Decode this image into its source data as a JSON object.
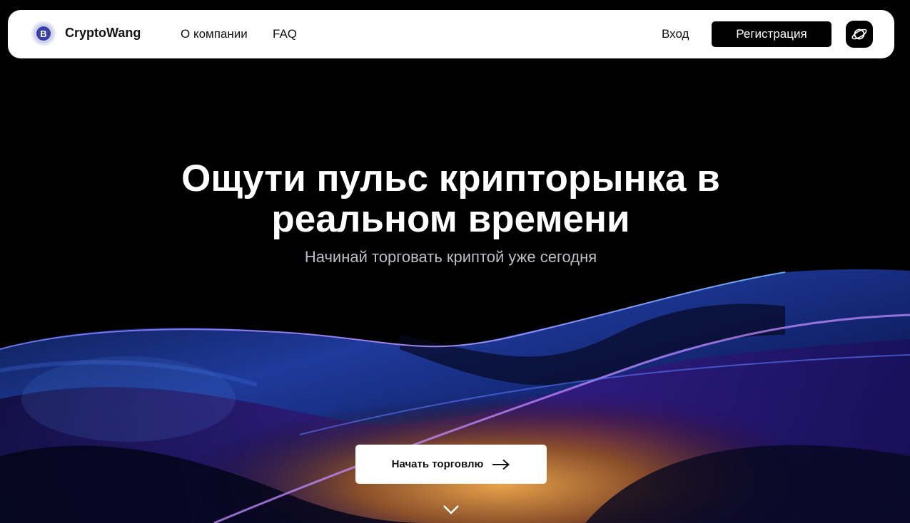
{
  "header": {
    "brand": "CryptoWang",
    "nav": [
      {
        "label": "О компании"
      },
      {
        "label": "FAQ"
      }
    ],
    "login_label": "Вход",
    "register_label": "Регистрация",
    "theme_icon": "planet-icon",
    "logo_icon": "bitcoin-logo-icon"
  },
  "hero": {
    "title_line1": "Ощути пульс крипторынка в",
    "title_line2": "реальном времени",
    "subtitle": "Начинай торговать криптой уже сегодня",
    "cta_label": "Начать торговлю",
    "cta_icon": "arrow-right-icon",
    "scroll_icon": "chevron-down-icon"
  },
  "colors": {
    "background": "#000000",
    "header_bg": "#ffffff",
    "accent_blue": "#3b4dff",
    "accent_purple": "#9b3cff",
    "accent_gold": "#c58a3a"
  }
}
